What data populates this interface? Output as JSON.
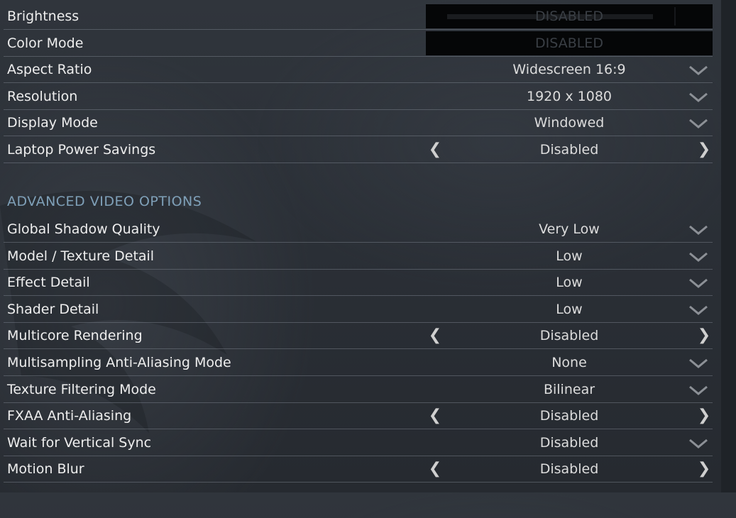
{
  "rows_top": [
    {
      "label": "Brightness",
      "value": "DISABLED",
      "control": "slider-disabled"
    },
    {
      "label": "Color Mode",
      "value": "DISABLED",
      "control": "disabled"
    },
    {
      "label": "Aspect Ratio",
      "value": "Widescreen 16:9",
      "control": "dropdown"
    },
    {
      "label": "Resolution",
      "value": "1920 x 1080",
      "control": "dropdown"
    },
    {
      "label": "Display Mode",
      "value": "Windowed",
      "control": "dropdown"
    },
    {
      "label": "Laptop Power Savings",
      "value": "Disabled",
      "control": "toggle"
    }
  ],
  "section_header": "ADVANCED VIDEO OPTIONS",
  "rows_advanced": [
    {
      "label": "Global Shadow Quality",
      "value": "Very Low",
      "control": "dropdown"
    },
    {
      "label": "Model / Texture Detail",
      "value": "Low",
      "control": "dropdown"
    },
    {
      "label": "Effect Detail",
      "value": "Low",
      "control": "dropdown"
    },
    {
      "label": "Shader Detail",
      "value": "Low",
      "control": "dropdown"
    },
    {
      "label": "Multicore Rendering",
      "value": "Disabled",
      "control": "toggle"
    },
    {
      "label": "Multisampling Anti-Aliasing Mode",
      "value": "None",
      "control": "dropdown"
    },
    {
      "label": "Texture Filtering Mode",
      "value": "Bilinear",
      "control": "dropdown"
    },
    {
      "label": "FXAA Anti-Aliasing",
      "value": "Disabled",
      "control": "toggle"
    },
    {
      "label": "Wait for Vertical Sync",
      "value": "Disabled",
      "control": "dropdown"
    },
    {
      "label": "Motion Blur",
      "value": "Disabled",
      "control": "toggle"
    }
  ],
  "icons": {
    "dropdown": "chevron-down-icon",
    "prev": "arrow-left-icon",
    "next": "arrow-right-icon"
  },
  "arrow_glyphs": {
    "prev": "❮",
    "next": "❯"
  },
  "colors": {
    "section_header": "#7fa0b8",
    "value_text": "#dcdcdc",
    "disabled_text": "#3a3f45"
  }
}
